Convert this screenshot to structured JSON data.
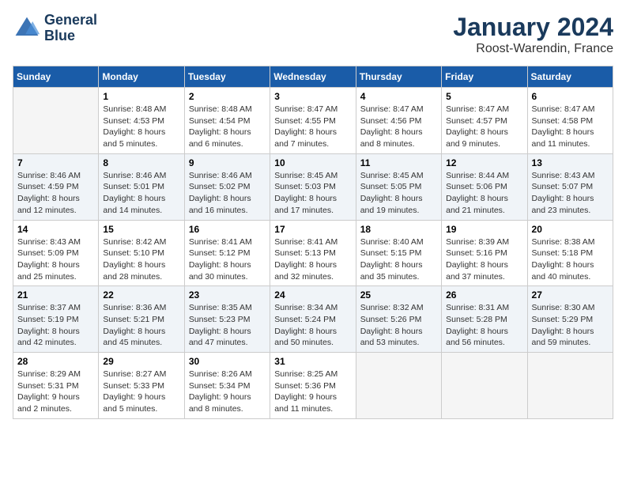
{
  "header": {
    "logo_line1": "General",
    "logo_line2": "Blue",
    "month_title": "January 2024",
    "location": "Roost-Warendin, France"
  },
  "days_of_week": [
    "Sunday",
    "Monday",
    "Tuesday",
    "Wednesday",
    "Thursday",
    "Friday",
    "Saturday"
  ],
  "weeks": [
    [
      {
        "num": "",
        "info": ""
      },
      {
        "num": "1",
        "info": "Sunrise: 8:48 AM\nSunset: 4:53 PM\nDaylight: 8 hours\nand 5 minutes."
      },
      {
        "num": "2",
        "info": "Sunrise: 8:48 AM\nSunset: 4:54 PM\nDaylight: 8 hours\nand 6 minutes."
      },
      {
        "num": "3",
        "info": "Sunrise: 8:47 AM\nSunset: 4:55 PM\nDaylight: 8 hours\nand 7 minutes."
      },
      {
        "num": "4",
        "info": "Sunrise: 8:47 AM\nSunset: 4:56 PM\nDaylight: 8 hours\nand 8 minutes."
      },
      {
        "num": "5",
        "info": "Sunrise: 8:47 AM\nSunset: 4:57 PM\nDaylight: 8 hours\nand 9 minutes."
      },
      {
        "num": "6",
        "info": "Sunrise: 8:47 AM\nSunset: 4:58 PM\nDaylight: 8 hours\nand 11 minutes."
      }
    ],
    [
      {
        "num": "7",
        "info": "Sunrise: 8:46 AM\nSunset: 4:59 PM\nDaylight: 8 hours\nand 12 minutes."
      },
      {
        "num": "8",
        "info": "Sunrise: 8:46 AM\nSunset: 5:01 PM\nDaylight: 8 hours\nand 14 minutes."
      },
      {
        "num": "9",
        "info": "Sunrise: 8:46 AM\nSunset: 5:02 PM\nDaylight: 8 hours\nand 16 minutes."
      },
      {
        "num": "10",
        "info": "Sunrise: 8:45 AM\nSunset: 5:03 PM\nDaylight: 8 hours\nand 17 minutes."
      },
      {
        "num": "11",
        "info": "Sunrise: 8:45 AM\nSunset: 5:05 PM\nDaylight: 8 hours\nand 19 minutes."
      },
      {
        "num": "12",
        "info": "Sunrise: 8:44 AM\nSunset: 5:06 PM\nDaylight: 8 hours\nand 21 minutes."
      },
      {
        "num": "13",
        "info": "Sunrise: 8:43 AM\nSunset: 5:07 PM\nDaylight: 8 hours\nand 23 minutes."
      }
    ],
    [
      {
        "num": "14",
        "info": "Sunrise: 8:43 AM\nSunset: 5:09 PM\nDaylight: 8 hours\nand 25 minutes."
      },
      {
        "num": "15",
        "info": "Sunrise: 8:42 AM\nSunset: 5:10 PM\nDaylight: 8 hours\nand 28 minutes."
      },
      {
        "num": "16",
        "info": "Sunrise: 8:41 AM\nSunset: 5:12 PM\nDaylight: 8 hours\nand 30 minutes."
      },
      {
        "num": "17",
        "info": "Sunrise: 8:41 AM\nSunset: 5:13 PM\nDaylight: 8 hours\nand 32 minutes."
      },
      {
        "num": "18",
        "info": "Sunrise: 8:40 AM\nSunset: 5:15 PM\nDaylight: 8 hours\nand 35 minutes."
      },
      {
        "num": "19",
        "info": "Sunrise: 8:39 AM\nSunset: 5:16 PM\nDaylight: 8 hours\nand 37 minutes."
      },
      {
        "num": "20",
        "info": "Sunrise: 8:38 AM\nSunset: 5:18 PM\nDaylight: 8 hours\nand 40 minutes."
      }
    ],
    [
      {
        "num": "21",
        "info": "Sunrise: 8:37 AM\nSunset: 5:19 PM\nDaylight: 8 hours\nand 42 minutes."
      },
      {
        "num": "22",
        "info": "Sunrise: 8:36 AM\nSunset: 5:21 PM\nDaylight: 8 hours\nand 45 minutes."
      },
      {
        "num": "23",
        "info": "Sunrise: 8:35 AM\nSunset: 5:23 PM\nDaylight: 8 hours\nand 47 minutes."
      },
      {
        "num": "24",
        "info": "Sunrise: 8:34 AM\nSunset: 5:24 PM\nDaylight: 8 hours\nand 50 minutes."
      },
      {
        "num": "25",
        "info": "Sunrise: 8:32 AM\nSunset: 5:26 PM\nDaylight: 8 hours\nand 53 minutes."
      },
      {
        "num": "26",
        "info": "Sunrise: 8:31 AM\nSunset: 5:28 PM\nDaylight: 8 hours\nand 56 minutes."
      },
      {
        "num": "27",
        "info": "Sunrise: 8:30 AM\nSunset: 5:29 PM\nDaylight: 8 hours\nand 59 minutes."
      }
    ],
    [
      {
        "num": "28",
        "info": "Sunrise: 8:29 AM\nSunset: 5:31 PM\nDaylight: 9 hours\nand 2 minutes."
      },
      {
        "num": "29",
        "info": "Sunrise: 8:27 AM\nSunset: 5:33 PM\nDaylight: 9 hours\nand 5 minutes."
      },
      {
        "num": "30",
        "info": "Sunrise: 8:26 AM\nSunset: 5:34 PM\nDaylight: 9 hours\nand 8 minutes."
      },
      {
        "num": "31",
        "info": "Sunrise: 8:25 AM\nSunset: 5:36 PM\nDaylight: 9 hours\nand 11 minutes."
      },
      {
        "num": "",
        "info": ""
      },
      {
        "num": "",
        "info": ""
      },
      {
        "num": "",
        "info": ""
      }
    ]
  ]
}
